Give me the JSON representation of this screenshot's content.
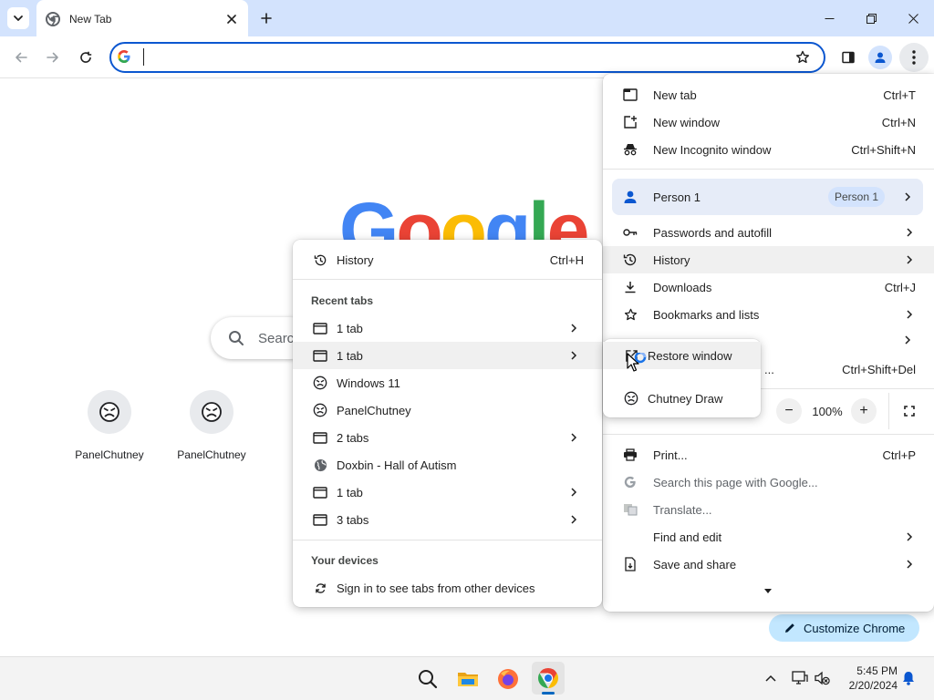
{
  "browser": {
    "tab_title": "New Tab",
    "new_tab_tooltip": "New tab"
  },
  "ntp": {
    "logo_letters": [
      "G",
      "o",
      "o",
      "g",
      "l",
      "e"
    ],
    "logo_colors": [
      "#4285f4",
      "#ea4335",
      "#fbbc05",
      "#4285f4",
      "#34a853",
      "#ea4335"
    ],
    "search_placeholder": "Search",
    "shortcuts": [
      {
        "label": "PanelChutney"
      },
      {
        "label": "PanelChutney"
      }
    ],
    "customize_label": "Customize Chrome"
  },
  "main_menu": {
    "new_tab": {
      "label": "New tab",
      "shortcut": "Ctrl+T"
    },
    "new_window": {
      "label": "New window",
      "shortcut": "Ctrl+N"
    },
    "new_incognito": {
      "label": "New Incognito window",
      "shortcut": "Ctrl+Shift+N"
    },
    "profile": {
      "label": "Person 1",
      "chip": "Person 1"
    },
    "passwords": {
      "label": "Passwords and autofill"
    },
    "history": {
      "label": "History"
    },
    "downloads": {
      "label": "Downloads",
      "shortcut": "Ctrl+J"
    },
    "bookmarks": {
      "label": "Bookmarks and lists"
    },
    "partial_label": "...",
    "partial_shortcut": "Ctrl+Shift+Del",
    "zoom": {
      "value": "100%",
      "minus": "−",
      "plus": "+"
    },
    "print": {
      "label": "Print...",
      "shortcut": "Ctrl+P"
    },
    "search_page": {
      "label": "Search this page with Google..."
    },
    "translate": {
      "label": "Translate..."
    },
    "find_edit": {
      "label": "Find and edit"
    },
    "save_share": {
      "label": "Save and share"
    }
  },
  "history_menu": {
    "history": {
      "label": "History",
      "shortcut": "Ctrl+H"
    },
    "recent_tabs_header": "Recent tabs",
    "items": [
      {
        "label": "1 tab",
        "icon": "window-icon",
        "submenu": true
      },
      {
        "label": "1 tab",
        "icon": "window-icon",
        "submenu": true
      },
      {
        "label": "Windows 11",
        "icon": "favicon-icon",
        "submenu": false
      },
      {
        "label": "PanelChutney",
        "icon": "favicon-icon",
        "submenu": false
      },
      {
        "label": "2 tabs",
        "icon": "window-icon",
        "submenu": true
      },
      {
        "label": "Doxbin - Hall of Autism",
        "icon": "globe-icon",
        "submenu": false
      },
      {
        "label": "1 tab",
        "icon": "window-icon",
        "submenu": true
      },
      {
        "label": "3 tabs",
        "icon": "window-icon",
        "submenu": true
      }
    ],
    "devices_header": "Your devices",
    "sign_in": "Sign in to see tabs from other devices"
  },
  "restore_menu": {
    "restore": {
      "label": "Restore window"
    },
    "chutney": {
      "label": "Chutney Draw"
    }
  },
  "taskbar": {
    "time": "5:45 PM",
    "date": "2/20/2024"
  },
  "colors": {
    "tabstrip": "#d3e3fd",
    "accent": "#0b57d0",
    "hover": "#f0f0f0",
    "profile_row": "#e6ecf8"
  }
}
